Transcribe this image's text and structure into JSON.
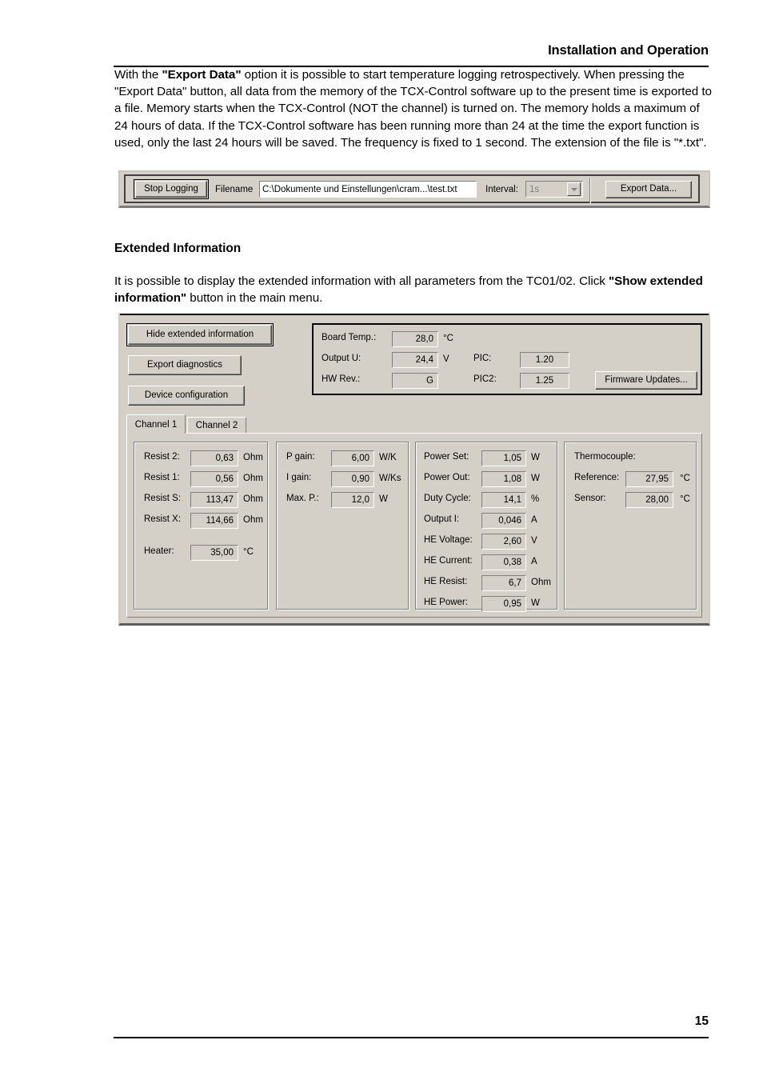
{
  "document": {
    "header": "Installation and Operation",
    "page_number": "15",
    "intro_paragraph_html": "With the <b>\"Export Data\"</b> option it is possible to start temperature logging retrospectively. When pressing the \"Export Data\" button, all data from the memory of the TCX-Control software up to the present time is exported to a file. Memory starts when the TCX-Control (NOT the channel) is turned on. The memory holds a maximum of 24 hours of data. If the TCX-Control software has been running more than 24 at the time the export function is used, only the last 24 hours will be saved. The frequency is fixed to 1 second. The extension of the file is \"*.txt\".",
    "section_heading": "Extended Information",
    "extended_paragraph_html": "It is possible to display the extended information with all parameters from the TC01/02. Click <b>\"Show extended information\"</b> button in the main menu."
  },
  "logging_toolbar": {
    "stop_logging_label": "Stop Logging",
    "filename_label": "Filename",
    "filename_value": "C:\\Dokumente und Einstellungen\\cram...\\test.txt",
    "interval_label": "Interval:",
    "interval_value": "1s",
    "export_data_label": "Export Data..."
  },
  "extended_panel": {
    "buttons": {
      "hide_extended": "Hide extended information",
      "export_diagnostics": "Export diagnostics",
      "device_configuration": "Device configuration",
      "firmware_updates": "Firmware Updates..."
    },
    "board_info": [
      {
        "label": "Board Temp.:",
        "value": "28,0",
        "unit": "°C"
      },
      {
        "label": "Output U:",
        "value": "24,4",
        "unit": "V"
      },
      {
        "label": "HW Rev.:",
        "value": "G",
        "unit": ""
      }
    ],
    "pic_info": [
      {
        "label": "PIC:",
        "value": "1.20"
      },
      {
        "label": "PIC2:",
        "value": "1.25"
      }
    ],
    "tabs": [
      {
        "label": "Channel 1",
        "active": true
      },
      {
        "label": "Channel 2",
        "active": false
      }
    ],
    "resist_group": [
      {
        "label": "Resist 2:",
        "value": "0,63",
        "unit": "Ohm"
      },
      {
        "label": "Resist 1:",
        "value": "0,56",
        "unit": "Ohm"
      },
      {
        "label": "Resist S:",
        "value": "113,47",
        "unit": "Ohm"
      },
      {
        "label": "Resist X:",
        "value": "114,66",
        "unit": "Ohm"
      },
      {
        "label": "Heater:",
        "value": "35,00",
        "unit": "°C"
      }
    ],
    "gain_group": [
      {
        "label": "P gain:",
        "value": "6,00",
        "unit": "W/K"
      },
      {
        "label": "I gain:",
        "value": "0,90",
        "unit": "W/Ks"
      },
      {
        "label": "Max. P.:",
        "value": "12,0",
        "unit": "W"
      }
    ],
    "power_group": [
      {
        "label": "Power Set:",
        "value": "1,05",
        "unit": "W"
      },
      {
        "label": "Power Out:",
        "value": "1,08",
        "unit": "W"
      },
      {
        "label": "Duty Cycle:",
        "value": "14,1",
        "unit": "%"
      },
      {
        "label": "Output I:",
        "value": "0,046",
        "unit": "A"
      },
      {
        "label": "HE Voltage:",
        "value": "2,60",
        "unit": "V"
      },
      {
        "label": "HE Current:",
        "value": "0,38",
        "unit": "A"
      },
      {
        "label": "HE Resist:",
        "value": "6,7",
        "unit": "Ohm"
      },
      {
        "label": "HE Power:",
        "value": "0,95",
        "unit": "W"
      }
    ],
    "thermocouple_group": {
      "title": "Thermocouple:",
      "rows": [
        {
          "label": "Reference:",
          "value": "27,95",
          "unit": "°C"
        },
        {
          "label": "Sensor:",
          "value": "28,00",
          "unit": "°C"
        }
      ]
    }
  },
  "colors": {
    "panel_face": "#d4d0c8",
    "shadow": "#808080",
    "highlight": "#ffffff",
    "text": "#000000",
    "disabled_text": "#808080"
  }
}
